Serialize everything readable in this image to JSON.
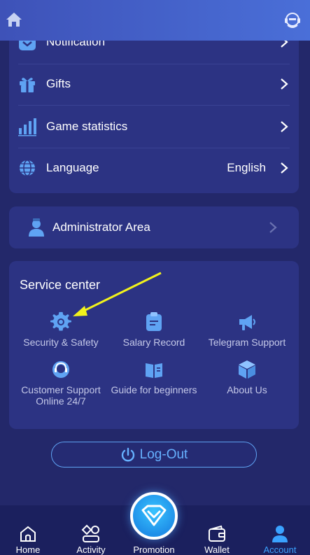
{
  "menu": {
    "items": [
      {
        "label": "Notification",
        "value": "",
        "icon": "notification-icon"
      },
      {
        "label": "Gifts",
        "value": "",
        "icon": "gift-icon"
      },
      {
        "label": "Game statistics",
        "value": "",
        "icon": "bar-chart-icon"
      },
      {
        "label": "Language",
        "value": "English",
        "icon": "globe-icon"
      }
    ]
  },
  "admin": {
    "label": "Administrator Area",
    "icon": "admin-icon"
  },
  "service": {
    "title": "Service center",
    "items": [
      {
        "label": "Security & Safety",
        "icon": "gear-icon"
      },
      {
        "label": "Salary Record",
        "icon": "clipboard-icon"
      },
      {
        "label": "Telegram Support",
        "icon": "megaphone-icon"
      },
      {
        "label": "Customer Support Online 24/7",
        "icon": "headset-icon"
      },
      {
        "label": "Guide for beginners",
        "icon": "book-icon"
      },
      {
        "label": "About Us",
        "icon": "cube-icon"
      }
    ]
  },
  "logout": {
    "label": "Log-Out"
  },
  "nav": {
    "items": [
      {
        "label": "Home",
        "active": false
      },
      {
        "label": "Activity",
        "active": false
      },
      {
        "label": "Promotion",
        "active": false
      },
      {
        "label": "Wallet",
        "active": false
      },
      {
        "label": "Account",
        "active": true
      }
    ]
  },
  "colors": {
    "background": "#23286a",
    "card": "#2c3383",
    "topbar": "#4a6fd8",
    "accent": "#3aa2ff",
    "icon": "#5fa3f3",
    "arrow": "#f2f21c"
  }
}
